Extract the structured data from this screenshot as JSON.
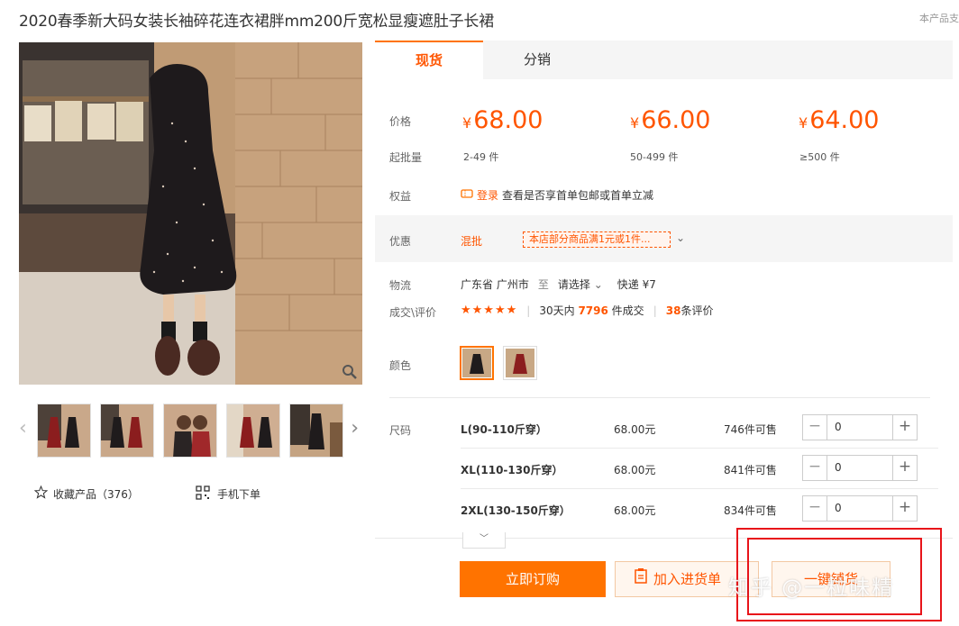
{
  "title": "2020春季新大码女装长袖碎花连衣裙胖mm200斤宽松显瘦遮肚子长裙",
  "top_right": "本产品支",
  "gallery": {
    "thumb_count": 5
  },
  "collect": {
    "label": "收藏产品（376）"
  },
  "mobile_order": {
    "label": "手机下单"
  },
  "tabs": [
    {
      "label": "现货"
    },
    {
      "label": "分销"
    }
  ],
  "price_label": "价格",
  "qty_label": "起批量",
  "prices": [
    {
      "symbol": "¥",
      "value": "68.00",
      "qty": "2-49 件"
    },
    {
      "symbol": "¥",
      "value": "66.00",
      "qty": "50-499 件"
    },
    {
      "symbol": "¥",
      "value": "64.00",
      "qty": "≥500 件"
    }
  ],
  "rights": {
    "label": "权益",
    "login": "登录",
    "text": "查看是否享首单包邮或首单立减"
  },
  "promo": {
    "label": "优惠",
    "type": "混批",
    "tag": "本店部分商品满1元或1件...",
    "chevron": "⌄"
  },
  "logistics": {
    "label": "物流",
    "origin": "广东省 广州市",
    "to": "至",
    "select": "请选择",
    "express": "快递 ¥7"
  },
  "deals": {
    "label": "成交\\评价",
    "stars": "★★★★★",
    "prefix": "30天内",
    "count": "7796",
    "suffix": "件成交",
    "reviews": "38",
    "reviews_suffix": "条评价"
  },
  "color_label": "颜色",
  "size_label": "尺码",
  "sizes": [
    {
      "name": "L(90-110斤穿）",
      "price": "68.00元",
      "stock": "746",
      "stock_suffix": "件可售",
      "qty": "0"
    },
    {
      "name": "XL(110-130斤穿）",
      "price": "68.00元",
      "stock": "841",
      "stock_suffix": "件可售",
      "qty": "0"
    },
    {
      "name": "2XL(130-150斤穿）",
      "price": "68.00元",
      "stock": "834",
      "stock_suffix": "件可售",
      "qty": "0"
    }
  ],
  "stepper": {
    "minus": "−",
    "plus": "+"
  },
  "buttons": {
    "order": "立即订购",
    "cart": "加入进货单",
    "distribute": "一键铺货"
  },
  "watermark": "知乎 @一粒味精",
  "colors": {
    "accent": "#ff7300",
    "price": "#ff5500",
    "annotation": "#e8141a"
  }
}
